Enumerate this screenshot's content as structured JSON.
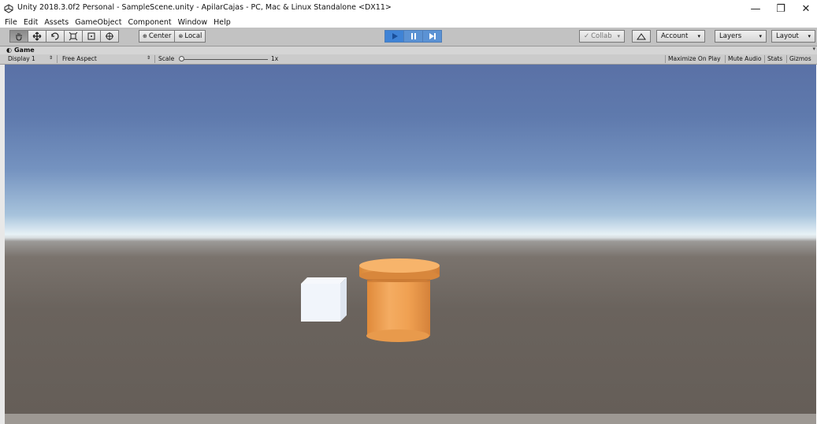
{
  "window": {
    "title": "Unity 2018.3.0f2 Personal - SampleScene.unity - ApilarCajas - PC, Mac & Linux Standalone <DX11>",
    "controls": {
      "minimize": "—",
      "restore": "❐",
      "close": "✕"
    }
  },
  "menu": [
    "File",
    "Edit",
    "Assets",
    "GameObject",
    "Component",
    "Window",
    "Help"
  ],
  "toolbar": {
    "tools": [
      "hand-tool",
      "move-tool",
      "rotate-tool",
      "scale-tool",
      "rect-tool",
      "transform-tool"
    ],
    "pivot_mode": "Center",
    "pivot_rotation": "Local",
    "collab": "Collab",
    "account": "Account",
    "layers": "Layers",
    "layout": "Layout",
    "play_state": "playing",
    "accent_color": "#3f83d6"
  },
  "game_view": {
    "tab_label": "Game",
    "display": "Display 1",
    "aspect": "Free Aspect",
    "scale_label": "Scale",
    "scale_value": "1x",
    "toggles": [
      "Maximize On Play",
      "Mute Audio",
      "Stats",
      "Gizmos"
    ]
  },
  "scene": {
    "objects": [
      {
        "name": "cube",
        "color": "#f2f5fb"
      },
      {
        "name": "cylinder",
        "color": "#f0a050"
      }
    ]
  }
}
